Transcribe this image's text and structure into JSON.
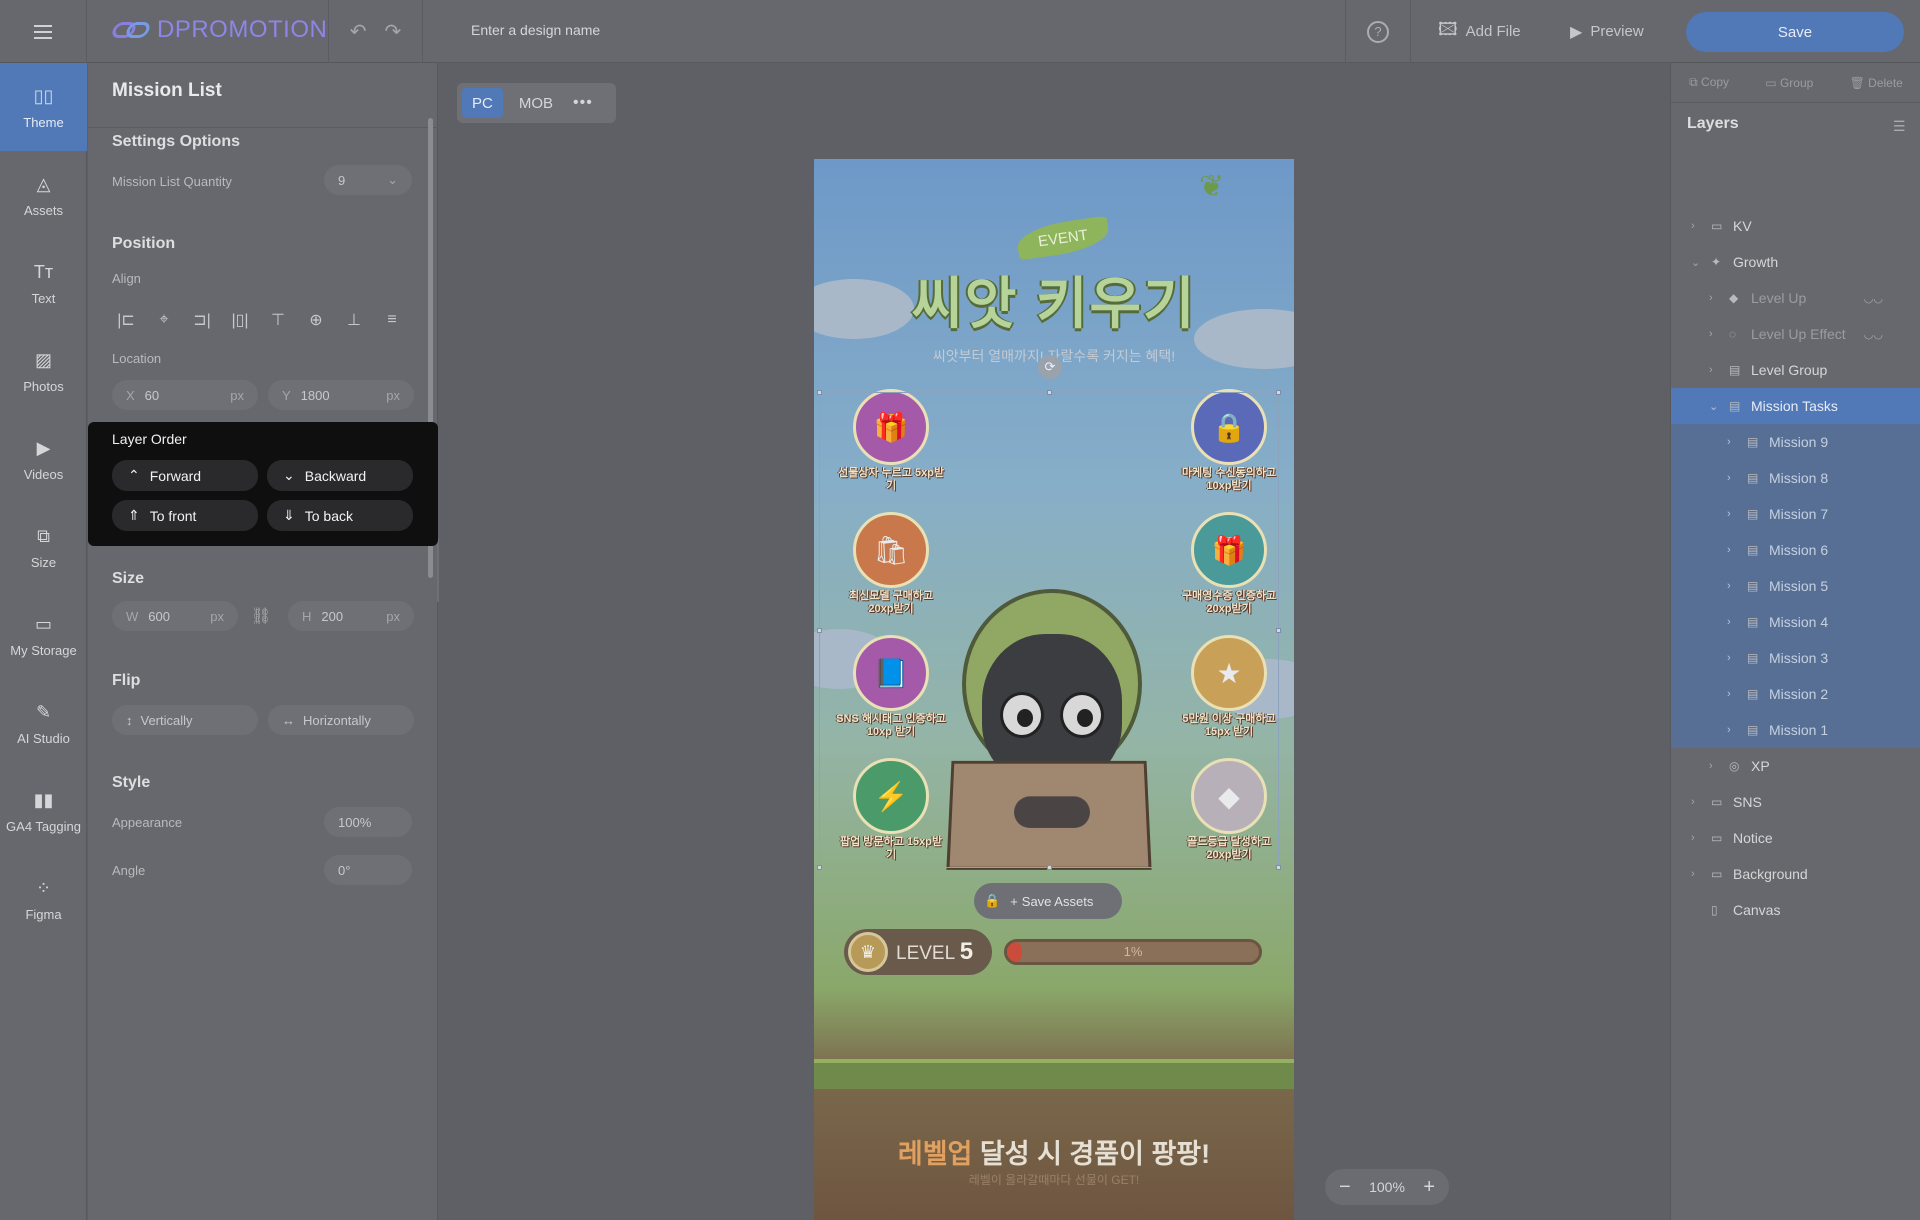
{
  "app": {
    "logo_text": "DPROMOTION"
  },
  "topbar": {
    "design_name_placeholder": "Enter a design name",
    "help_label": "?",
    "add_file_label": "Add File",
    "preview_label": "Preview",
    "save_label": "Save"
  },
  "nav": [
    {
      "label": "Theme",
      "icon": "theme-icon",
      "glyph": "▯▯"
    },
    {
      "label": "Assets",
      "icon": "shapes-icon",
      "glyph": "◬"
    },
    {
      "label": "Text",
      "icon": "text-icon",
      "glyph": "Tт"
    },
    {
      "label": "Photos",
      "icon": "image-icon",
      "glyph": "▨"
    },
    {
      "label": "Videos",
      "icon": "video-icon",
      "glyph": "▶"
    },
    {
      "label": "Size",
      "icon": "resize-icon",
      "glyph": "⧉"
    },
    {
      "label": "My Storage",
      "icon": "folder-icon",
      "glyph": "▭"
    },
    {
      "label": "AI Studio",
      "icon": "magic-wand-icon",
      "glyph": "✎"
    },
    {
      "label": "GA4 Tagging",
      "icon": "analytics-icon",
      "glyph": "▮▮"
    },
    {
      "label": "Figma",
      "icon": "figma-icon",
      "glyph": "⁘"
    }
  ],
  "panel": {
    "title": "Mission List",
    "settings_heading": "Settings Options",
    "mission_qty_label": "Mission List Quantity",
    "mission_qty_value": "9",
    "position_heading": "Position",
    "align_label": "Align",
    "location_label": "Location",
    "x_key": "X",
    "x_value": "60",
    "x_unit": "px",
    "y_key": "Y",
    "y_value": "1800",
    "y_unit": "px",
    "size_heading": "Size",
    "w_key": "W",
    "w_value": "600",
    "w_unit": "px",
    "h_key": "H",
    "h_value": "200",
    "h_unit": "px",
    "flip_heading": "Flip",
    "flip_vertical": "Vertically",
    "flip_horizontal": "Horizontally",
    "style_heading": "Style",
    "appearance_label": "Appearance",
    "appearance_value": "100%",
    "angle_label": "Angle",
    "angle_value": "0°"
  },
  "layer_order": {
    "title": "Layer Order",
    "forward": "Forward",
    "backward": "Backward",
    "to_front": "To front",
    "to_back": "To back"
  },
  "canvas": {
    "device_tabs": [
      "PC",
      "MOB"
    ],
    "active_tab": "PC",
    "zoom": "100%",
    "save_assets": "Save Assets",
    "art": {
      "event": "EVENT",
      "title": "씨앗 키우기",
      "subtitle": "씨앗부터 열매까지! 자랄수록 커지는 혜택!",
      "level_word": "LEVEL",
      "level_num": "5",
      "progress_percent": 1,
      "progress_label": "1%",
      "bottom_highlight": "레벨업",
      "bottom_rest": " 달성 시 경품이 팡팡!",
      "bottom_sub": "레벨이 올라갈때마다 선물이 GET!",
      "missions": [
        {
          "text": "선물상자 누르고 5xp받기",
          "color": "#a45aa8",
          "glyph": "🎁"
        },
        {
          "text": "마케팅 수신동의하고 10xp받기",
          "color": "#5a6ab8",
          "glyph": "🔒"
        },
        {
          "text": "최신모델 구매하고 20xp받기",
          "color": "#c8784a",
          "glyph": "🛍"
        },
        {
          "text": "구매영수증 인증하고 20xp받기",
          "color": "#4a9a9a",
          "glyph": "🎁"
        },
        {
          "text": "SNS 해시태그 인증하고 10xp 받기",
          "color": "#a45aa8",
          "glyph": "📘"
        },
        {
          "text": "5만원 이상 구매하고 15px 받기",
          "color": "#c8a058",
          "glyph": "★"
        },
        {
          "text": "팝업 방문하고 15xp받기",
          "color": "#4a9a6a",
          "glyph": "⚡"
        },
        {
          "text": "골드등급 달성하고 20xp받기",
          "color": "#b8b0b8",
          "glyph": "◆"
        }
      ]
    }
  },
  "right": {
    "tools": [
      "Copy",
      "Group",
      "Delete"
    ],
    "layers_heading": "Layers",
    "layers": [
      {
        "label": "KV",
        "indent": 0,
        "chev": "›",
        "icon": "folder-icon",
        "glyph": "▭",
        "state": ""
      },
      {
        "label": "Growth",
        "indent": 0,
        "chev": "⌄",
        "icon": "effects-icon",
        "glyph": "✦",
        "state": ""
      },
      {
        "label": "Level Up",
        "indent": 1,
        "chev": "›",
        "icon": "shape-icon",
        "glyph": "◆",
        "state": "dim",
        "eye": true
      },
      {
        "label": "Level Up Effect",
        "indent": 1,
        "chev": "›",
        "icon": "effect-icon",
        "glyph": "◌",
        "state": "dim",
        "eye": true
      },
      {
        "label": "Level Group",
        "indent": 1,
        "chev": "›",
        "icon": "group-icon",
        "glyph": "▤",
        "state": ""
      },
      {
        "label": "Mission Tasks",
        "indent": 1,
        "chev": "⌄",
        "icon": "list-icon",
        "glyph": "▤",
        "state": "sel"
      },
      {
        "label": "Mission 9",
        "indent": 2,
        "chev": "›",
        "icon": "list-icon",
        "glyph": "▤",
        "state": "selc"
      },
      {
        "label": "Mission 8",
        "indent": 2,
        "chev": "›",
        "icon": "list-icon",
        "glyph": "▤",
        "state": "selc"
      },
      {
        "label": "Mission 7",
        "indent": 2,
        "chev": "›",
        "icon": "list-icon",
        "glyph": "▤",
        "state": "selc"
      },
      {
        "label": "Mission 6",
        "indent": 2,
        "chev": "›",
        "icon": "list-icon",
        "glyph": "▤",
        "state": "selc"
      },
      {
        "label": "Mission 5",
        "indent": 2,
        "chev": "›",
        "icon": "list-icon",
        "glyph": "▤",
        "state": "selc"
      },
      {
        "label": "Mission 4",
        "indent": 2,
        "chev": "›",
        "icon": "list-icon",
        "glyph": "▤",
        "state": "selc"
      },
      {
        "label": "Mission 3",
        "indent": 2,
        "chev": "›",
        "icon": "list-icon",
        "glyph": "▤",
        "state": "selc"
      },
      {
        "label": "Mission 2",
        "indent": 2,
        "chev": "›",
        "icon": "list-icon",
        "glyph": "▤",
        "state": "selc"
      },
      {
        "label": "Mission 1",
        "indent": 2,
        "chev": "›",
        "icon": "list-icon",
        "glyph": "▤",
        "state": "selc"
      },
      {
        "label": "XP",
        "indent": 1,
        "chev": "›",
        "icon": "xp-icon",
        "glyph": "◎",
        "state": ""
      },
      {
        "label": "SNS",
        "indent": 0,
        "chev": "›",
        "icon": "folder-icon",
        "glyph": "▭",
        "state": ""
      },
      {
        "label": "Notice",
        "indent": 0,
        "chev": "›",
        "icon": "folder-icon",
        "glyph": "▭",
        "state": ""
      },
      {
        "label": "Background",
        "indent": 0,
        "chev": "›",
        "icon": "folder-icon",
        "glyph": "▭",
        "state": ""
      },
      {
        "label": "Canvas",
        "indent": 0,
        "chev": "",
        "icon": "canvas-icon",
        "glyph": "▯",
        "state": ""
      }
    ]
  }
}
